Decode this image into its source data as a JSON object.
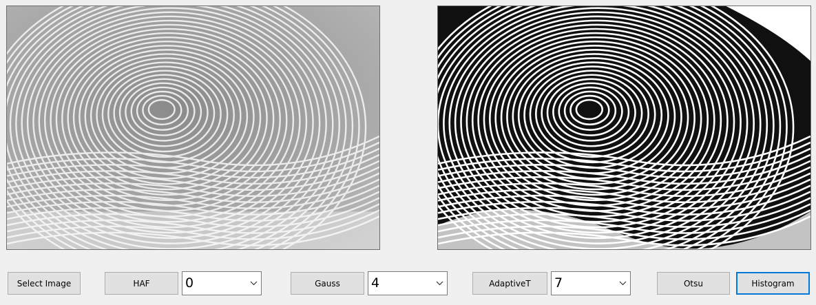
{
  "images": {
    "source": {
      "name": "fingerprint-grayscale"
    },
    "result": {
      "name": "fingerprint-binarized"
    }
  },
  "toolbar": {
    "select_image_label": "Select Image",
    "haf_label": "HAF",
    "haf_value": "0",
    "gauss_label": "Gauss",
    "gauss_value": "4",
    "adaptive_label": "AdaptiveT",
    "adaptive_value": "7",
    "otsu_label": "Otsu",
    "histogram_label": "Histogram"
  },
  "icons": {
    "dropdown": "chevron-down-icon"
  },
  "colors": {
    "background": "#f0f0f0",
    "button": "#e1e1e1",
    "focus": "#0078d7"
  }
}
